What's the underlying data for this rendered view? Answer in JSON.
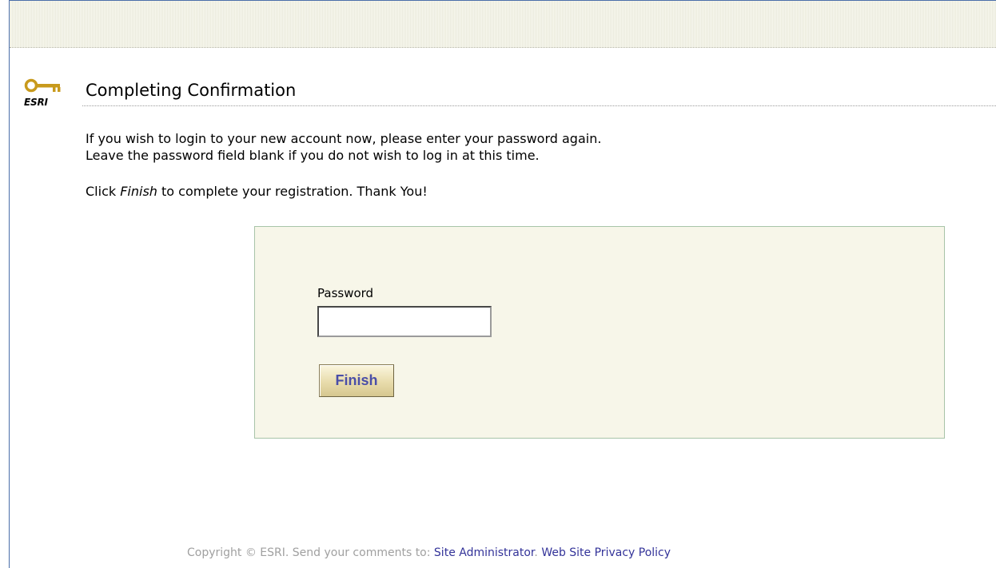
{
  "logo": {
    "text": "ESRI",
    "icon": "key-icon"
  },
  "page": {
    "title": "Completing Confirmation",
    "intro_line1": "If you wish to login to your new account now, please enter your password again.",
    "intro_line2": "Leave the password field blank if you do not wish to log in at this time.",
    "instruction_prefix": "Click ",
    "instruction_emphasis": "Finish",
    "instruction_suffix": " to complete your registration. Thank You!"
  },
  "form": {
    "password_label": "Password",
    "password_value": "",
    "finish_label": "Finish"
  },
  "footer": {
    "copyright_text": "Copyright © ESRI. Send your comments to: ",
    "admin_link": "Site Administrator",
    "separator": ". ",
    "privacy_link": "Web Site Privacy Policy"
  },
  "colors": {
    "frame_border": "#4a6ea9",
    "form_background": "#f7f6e9",
    "link": "#333399",
    "button_text": "#4a4ea8"
  }
}
